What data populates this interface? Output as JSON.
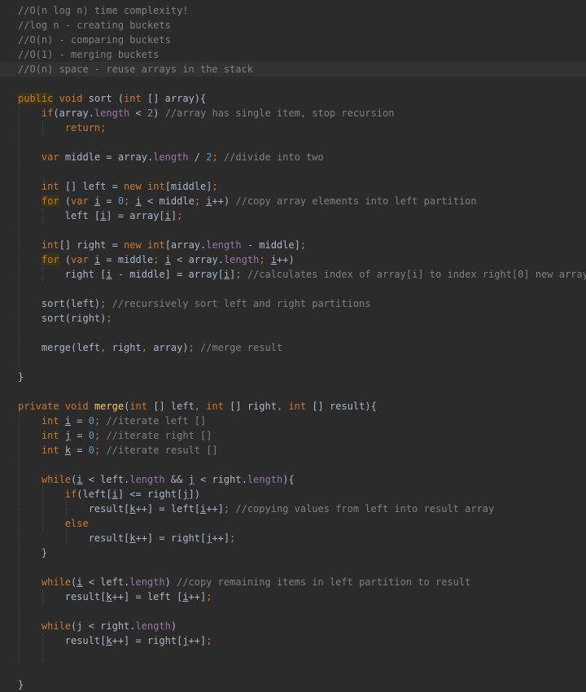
{
  "editor": {
    "colors": {
      "background": "#2b2b2b",
      "text": "#a9b7c6",
      "keyword": "#cc7832",
      "number": "#6897bb",
      "comment": "#808080",
      "field": "#9876aa",
      "method": "#ffc66d"
    },
    "lines": [
      [
        {
          "t": "//O(n log n) time complexity!",
          "c": "cmt"
        }
      ],
      [
        {
          "t": "//log n - creating buckets",
          "c": "cmt"
        }
      ],
      [
        {
          "t": "//O(n) - comparing buckets",
          "c": "cmt"
        }
      ],
      [
        {
          "t": "//O(1) - merging buckets",
          "c": "cmt"
        }
      ],
      [
        {
          "t": "//O(n) space - reuse arrays in the stack",
          "c": "cmt"
        }
      ],
      [],
      [
        {
          "t": "public",
          "c": "kw hlword"
        },
        {
          "t": " "
        },
        {
          "t": "void",
          "c": "kw"
        },
        {
          "t": " sort ("
        },
        {
          "t": "int",
          "c": "kw"
        },
        {
          "t": " [] array){"
        }
      ],
      [
        {
          "t": "    "
        },
        {
          "t": "if",
          "c": "kw"
        },
        {
          "t": "(array."
        },
        {
          "t": "length",
          "c": "fld"
        },
        {
          "t": " < "
        },
        {
          "t": "2",
          "c": "num"
        },
        {
          "t": ") "
        },
        {
          "t": "//array has single item, stop recursion",
          "c": "cmt"
        }
      ],
      [
        {
          "t": "        "
        },
        {
          "t": "return",
          "c": "kw"
        },
        {
          "t": ";",
          "c": "kw"
        }
      ],
      [],
      [
        {
          "t": "    "
        },
        {
          "t": "var",
          "c": "kw"
        },
        {
          "t": " middle = array."
        },
        {
          "t": "length",
          "c": "fld"
        },
        {
          "t": " / "
        },
        {
          "t": "2",
          "c": "num"
        },
        {
          "t": "; ",
          "c": "kw"
        },
        {
          "t": "//divide into two",
          "c": "cmt"
        }
      ],
      [],
      [
        {
          "t": "    "
        },
        {
          "t": "int",
          "c": "kw"
        },
        {
          "t": " [] left = "
        },
        {
          "t": "new",
          "c": "kw"
        },
        {
          "t": " "
        },
        {
          "t": "int",
          "c": "kw"
        },
        {
          "t": "[middle]"
        },
        {
          "t": ";",
          "c": "kw"
        }
      ],
      [
        {
          "t": "    "
        },
        {
          "t": "for",
          "c": "kw hlword"
        },
        {
          "t": " ("
        },
        {
          "t": "var",
          "c": "kw"
        },
        {
          "t": " "
        },
        {
          "t": "i",
          "c": "u"
        },
        {
          "t": " = "
        },
        {
          "t": "0",
          "c": "num"
        },
        {
          "t": "; ",
          "c": "kw"
        },
        {
          "t": "i",
          "c": "u"
        },
        {
          "t": " < middle"
        },
        {
          "t": "; ",
          "c": "kw"
        },
        {
          "t": "i",
          "c": "u"
        },
        {
          "t": "++) "
        },
        {
          "t": "//copy array elements into left partition",
          "c": "cmt"
        }
      ],
      [
        {
          "t": "        left ["
        },
        {
          "t": "i",
          "c": "u"
        },
        {
          "t": "] = array["
        },
        {
          "t": "i",
          "c": "u"
        },
        {
          "t": "]"
        },
        {
          "t": ";",
          "c": "kw"
        }
      ],
      [],
      [
        {
          "t": "    "
        },
        {
          "t": "int",
          "c": "kw"
        },
        {
          "t": "[] right = "
        },
        {
          "t": "new",
          "c": "kw"
        },
        {
          "t": " "
        },
        {
          "t": "int",
          "c": "kw"
        },
        {
          "t": "[array."
        },
        {
          "t": "length",
          "c": "fld"
        },
        {
          "t": " - middle]"
        },
        {
          "t": ";",
          "c": "kw"
        }
      ],
      [
        {
          "t": "    "
        },
        {
          "t": "for",
          "c": "kw hlword"
        },
        {
          "t": " ("
        },
        {
          "t": "var",
          "c": "kw"
        },
        {
          "t": " "
        },
        {
          "t": "i",
          "c": "u"
        },
        {
          "t": " = middle"
        },
        {
          "t": "; ",
          "c": "kw"
        },
        {
          "t": "i",
          "c": "u"
        },
        {
          "t": " < array."
        },
        {
          "t": "length",
          "c": "fld"
        },
        {
          "t": "; ",
          "c": "kw"
        },
        {
          "t": "i",
          "c": "u"
        },
        {
          "t": "++)"
        }
      ],
      [
        {
          "t": "        right ["
        },
        {
          "t": "i",
          "c": "u"
        },
        {
          "t": " - middle] = array["
        },
        {
          "t": "i",
          "c": "u"
        },
        {
          "t": "]"
        },
        {
          "t": "; ",
          "c": "kw"
        },
        {
          "t": "//calculates index of array[i] to index right[0] new array",
          "c": "cmt"
        }
      ],
      [],
      [
        {
          "t": "    sort(left)"
        },
        {
          "t": "; ",
          "c": "kw"
        },
        {
          "t": "//recursively sort left and right partitions",
          "c": "cmt"
        }
      ],
      [
        {
          "t": "    sort(right)"
        },
        {
          "t": ";",
          "c": "kw"
        }
      ],
      [],
      [
        {
          "t": "    merge(left"
        },
        {
          "t": ", ",
          "c": "kw"
        },
        {
          "t": "right"
        },
        {
          "t": ", ",
          "c": "kw"
        },
        {
          "t": "array)"
        },
        {
          "t": "; ",
          "c": "kw"
        },
        {
          "t": "//merge result",
          "c": "cmt"
        }
      ],
      [],
      [
        {
          "t": "}"
        }
      ],
      [],
      [
        {
          "t": "private",
          "c": "kw"
        },
        {
          "t": " "
        },
        {
          "t": "void",
          "c": "kw"
        },
        {
          "t": " "
        },
        {
          "t": "merge",
          "c": "fn"
        },
        {
          "t": "("
        },
        {
          "t": "int",
          "c": "kw"
        },
        {
          "t": " [] left"
        },
        {
          "t": ", ",
          "c": "kw"
        },
        {
          "t": "int",
          "c": "kw"
        },
        {
          "t": " [] right"
        },
        {
          "t": ", ",
          "c": "kw"
        },
        {
          "t": "int",
          "c": "kw"
        },
        {
          "t": " [] result){"
        }
      ],
      [
        {
          "t": "    "
        },
        {
          "t": "int",
          "c": "kw"
        },
        {
          "t": " "
        },
        {
          "t": "i",
          "c": "u"
        },
        {
          "t": " = "
        },
        {
          "t": "0",
          "c": "num"
        },
        {
          "t": "; ",
          "c": "kw"
        },
        {
          "t": "//iterate left []",
          "c": "cmt"
        }
      ],
      [
        {
          "t": "    "
        },
        {
          "t": "int",
          "c": "kw"
        },
        {
          "t": " "
        },
        {
          "t": "j",
          "c": "u"
        },
        {
          "t": " = "
        },
        {
          "t": "0",
          "c": "num"
        },
        {
          "t": "; ",
          "c": "kw"
        },
        {
          "t": "//iterate right []",
          "c": "cmt"
        }
      ],
      [
        {
          "t": "    "
        },
        {
          "t": "int",
          "c": "kw"
        },
        {
          "t": " "
        },
        {
          "t": "k",
          "c": "u"
        },
        {
          "t": " = "
        },
        {
          "t": "0",
          "c": "num"
        },
        {
          "t": "; ",
          "c": "kw"
        },
        {
          "t": "//iterate result []",
          "c": "cmt"
        }
      ],
      [],
      [
        {
          "t": "    "
        },
        {
          "t": "while",
          "c": "kw"
        },
        {
          "t": "("
        },
        {
          "t": "i",
          "c": "u"
        },
        {
          "t": " < left."
        },
        {
          "t": "length",
          "c": "fld"
        },
        {
          "t": " && "
        },
        {
          "t": "j",
          "c": "u"
        },
        {
          "t": " < right."
        },
        {
          "t": "length",
          "c": "fld"
        },
        {
          "t": "){"
        }
      ],
      [
        {
          "t": "        "
        },
        {
          "t": "if",
          "c": "kw"
        },
        {
          "t": "(left["
        },
        {
          "t": "i",
          "c": "u"
        },
        {
          "t": "] <= right["
        },
        {
          "t": "j",
          "c": "u"
        },
        {
          "t": "])"
        }
      ],
      [
        {
          "t": "            result["
        },
        {
          "t": "k",
          "c": "u"
        },
        {
          "t": "++] = left["
        },
        {
          "t": "i",
          "c": "u"
        },
        {
          "t": "++]"
        },
        {
          "t": "; ",
          "c": "kw"
        },
        {
          "t": "//copying values from left into result array",
          "c": "cmt"
        }
      ],
      [
        {
          "t": "        "
        },
        {
          "t": "else",
          "c": "kw"
        }
      ],
      [
        {
          "t": "            result["
        },
        {
          "t": "k",
          "c": "u"
        },
        {
          "t": "++] = right["
        },
        {
          "t": "j",
          "c": "u"
        },
        {
          "t": "++]"
        },
        {
          "t": ";",
          "c": "kw"
        }
      ],
      [
        {
          "t": "    }"
        }
      ],
      [],
      [
        {
          "t": "    "
        },
        {
          "t": "while",
          "c": "kw"
        },
        {
          "t": "("
        },
        {
          "t": "i",
          "c": "u"
        },
        {
          "t": " < left."
        },
        {
          "t": "length",
          "c": "fld"
        },
        {
          "t": ") "
        },
        {
          "t": "//copy remaining items in left partition to result",
          "c": "cmt"
        }
      ],
      [
        {
          "t": "        result["
        },
        {
          "t": "k",
          "c": "u"
        },
        {
          "t": "++] = left ["
        },
        {
          "t": "i",
          "c": "u"
        },
        {
          "t": "++]"
        },
        {
          "t": ";",
          "c": "kw"
        }
      ],
      [],
      [
        {
          "t": "    "
        },
        {
          "t": "while",
          "c": "kw"
        },
        {
          "t": "(j < right."
        },
        {
          "t": "length",
          "c": "fld"
        },
        {
          "t": ")"
        }
      ],
      [
        {
          "t": "        result["
        },
        {
          "t": "k",
          "c": "u"
        },
        {
          "t": "++] = right["
        },
        {
          "t": "j",
          "c": "u"
        },
        {
          "t": "++]"
        },
        {
          "t": ";",
          "c": "kw"
        }
      ],
      [],
      [],
      [
        {
          "t": "}"
        }
      ]
    ]
  }
}
